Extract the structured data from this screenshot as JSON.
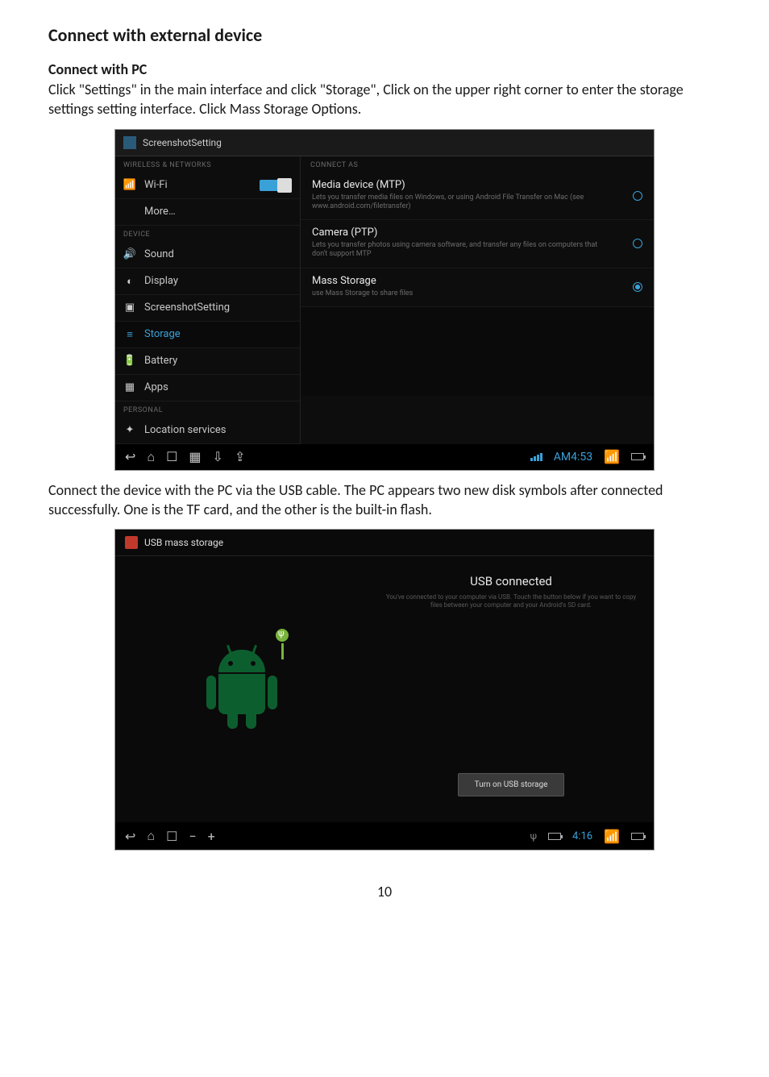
{
  "doc": {
    "title": "Connect with external device",
    "subtitle": "Connect with PC",
    "intro": "Click \"Settings\" in the main interface and click \"Storage\", Click on the upper right corner to enter the storage settings setting interface. Click Mass Storage Options.",
    "mid": "Connect the device with the PC via the USB cable. The PC appears two new disk symbols after connected successfully. One is the TF card, and the other is the built-in flash.",
    "page": "10"
  },
  "s1": {
    "title": "ScreenshotSetting",
    "left": {
      "catWireless": "WIRELESS & NETWORKS",
      "wifi": "Wi-Fi",
      "more": "More…",
      "catDevice": "DEVICE",
      "sound": "Sound",
      "display": "Display",
      "screenshot": "ScreenshotSetting",
      "storage": "Storage",
      "battery": "Battery",
      "apps": "Apps",
      "catPersonal": "PERSONAL",
      "location": "Location services"
    },
    "right": {
      "hdr": "CONNECT AS",
      "mtpTitle": "Media device (MTP)",
      "mtpDesc": "Lets you transfer media files on Windows, or using Android File Transfer on Mac (see www.android.com/filetransfer)",
      "ptpTitle": "Camera (PTP)",
      "ptpDesc": "Lets you transfer photos using camera software, and transfer any files on computers that don't support MTP",
      "massTitle": "Mass Storage",
      "massDesc": "use Mass Storage to share files"
    },
    "status": {
      "time": "AM4:53"
    }
  },
  "s2": {
    "title": "USB mass storage",
    "hdr": "USB connected",
    "desc": "You've connected to your computer via USB. Touch the button below if you want to copy files between your computer and your Android's SD card.",
    "btn": "Turn on USB storage",
    "status": {
      "time": "4:16"
    }
  }
}
